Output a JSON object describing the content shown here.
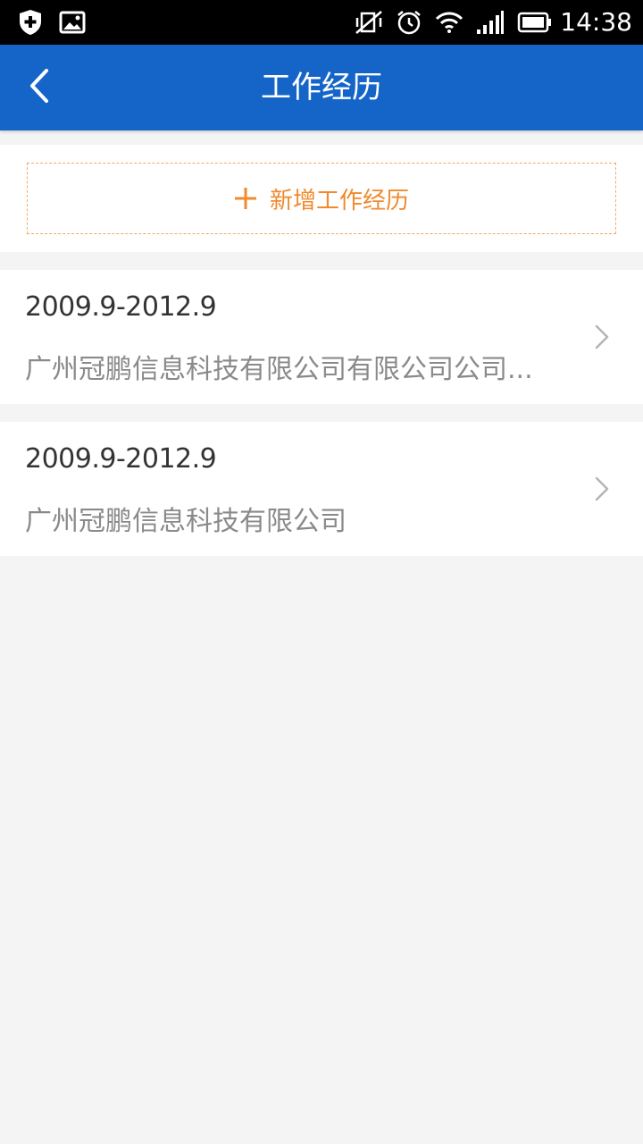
{
  "status_bar": {
    "time": "14:38",
    "icons": [
      "shield-plus-icon",
      "image-icon",
      "vibrate-off-icon",
      "alarm-icon",
      "wifi-icon",
      "signal-icon",
      "battery-icon"
    ]
  },
  "header": {
    "title": "工作经历",
    "back_icon": "chevron-left-icon"
  },
  "add_button": {
    "label": "新增工作经历",
    "icon": "plus-icon"
  },
  "jobs": [
    {
      "period": "2009.9-2012.9",
      "company": "广州冠鹏信息科技有限公司有限公司公司..."
    },
    {
      "period": "2009.9-2012.9",
      "company": "广州冠鹏信息科技有限公司"
    }
  ],
  "colors": {
    "app_bar": "#1565c9",
    "accent": "#f08a2c",
    "background": "#f4f4f4"
  }
}
